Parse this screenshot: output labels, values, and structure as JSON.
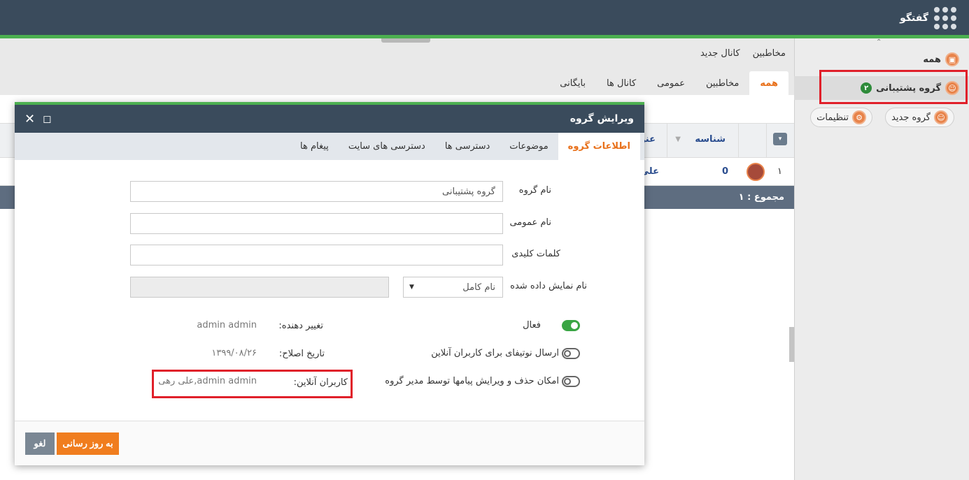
{
  "app": {
    "title": "گفتگو"
  },
  "sidebar": {
    "items": [
      {
        "label": "همه"
      },
      {
        "label": "گروه پشتیبانی",
        "badge": "۲"
      }
    ],
    "new_group": "گروه جدید",
    "settings": "تنظیمات"
  },
  "main": {
    "submenu": [
      "مخاطبین",
      "کانال جدید"
    ],
    "tabs": [
      "همه",
      "مخاطبین",
      "عمومی",
      "کانال ها",
      "بایگانی"
    ],
    "grid": {
      "columns": [
        "شناسه",
        "عنو"
      ],
      "row": {
        "index": "۱",
        "id": "0",
        "title": "علی"
      },
      "total": "مجموع : ۱"
    }
  },
  "modal": {
    "title": "ویرایش گروه",
    "tabs": [
      "اطلاعات گروه",
      "موضوعات",
      "دسترسی ها",
      "دسترسی های سایت",
      "پیغام ها"
    ],
    "fields": {
      "group_name_label": "نام گروه",
      "group_name_value": "گروه پشتیبانی",
      "public_name_label": "نام عمومی",
      "keywords_label": "کلمات کلیدی",
      "display_name_label": "نام نمایش داده شده",
      "display_name_select": "نام کامل"
    },
    "toggles": {
      "active_label": "فعال",
      "notify_label": "ارسال نوتیفای برای کاربران آنلاین",
      "edit_delete_label": "امکان حذف و ویرایش پیامها توسط مدیر گروه"
    },
    "info": {
      "modifier_label": "تغییر دهنده:",
      "modifier_value": "admin admin",
      "modified_date_label": "تاریخ اصلاح:",
      "modified_date_value": "۱۳۹۹/۰۸/۲۶",
      "online_users_label": "کاربران آنلاین:",
      "online_users_value": "علی رهی,admin admin"
    },
    "buttons": {
      "update": "به روز رسانی",
      "cancel": "لغو"
    }
  },
  "colors": {
    "header": "#3a4b5c",
    "accent": "#f07d1e",
    "green": "#4caf50",
    "highlight": "#e0202a"
  }
}
